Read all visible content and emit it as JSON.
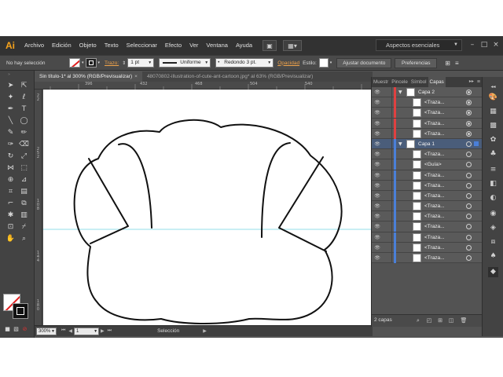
{
  "app": {
    "logo": "Ai"
  },
  "menubar": {
    "items": [
      "Archivo",
      "Edición",
      "Objeto",
      "Texto",
      "Seleccionar",
      "Efecto",
      "Ver",
      "Ventana",
      "Ayuda"
    ],
    "workspace": "Aspectos esenciales",
    "window_controls": {
      "minimize": "–",
      "maximize": "□",
      "close": "×"
    }
  },
  "controlbar": {
    "selection_status": "No hay selección",
    "stroke_label": "Trazo:",
    "stroke_weight": "1 pt",
    "stroke_profile": "Uniforme",
    "brush": "Redondo 3 pt.",
    "opacity_label": "Opacidad",
    "style_label": "Estilo:",
    "doc_setup_button": "Ajustar documento",
    "preferences_button": "Preferencias"
  },
  "tabs": [
    {
      "label": "Sin título-1* al 300% (RGB/Previsualizar)",
      "active": true
    },
    {
      "label": "48070802-illustration-of-cute-ant-cartoon.jpg* al 63% (RGB/Previsualizar)",
      "active": false
    }
  ],
  "ruler": {
    "top_labels": [
      "396",
      "432",
      "468",
      "504",
      "540"
    ],
    "left_labels": [
      "2\n2",
      "2\n5\n2",
      "1\n0\n8",
      "1\n4\n4",
      "1\n8\n0"
    ]
  },
  "statusbar": {
    "zoom": "300%",
    "artboard": "1",
    "tool_name": "Selección"
  },
  "layers_panel": {
    "tabs": [
      "Muestr",
      "Pincele",
      "Símbol",
      "Capas"
    ],
    "active_tab": "Capas",
    "layers": [
      {
        "name": "Capa 2",
        "level": 0,
        "expanded": true,
        "color": "#e04040",
        "target": "filled"
      },
      {
        "name": "<Traza...",
        "level": 1,
        "color": "#e04040",
        "target": "filled"
      },
      {
        "name": "<Traza...",
        "level": 1,
        "color": "#e04040",
        "target": "filled"
      },
      {
        "name": "<Traza...",
        "level": 1,
        "color": "#e04040",
        "target": "filled"
      },
      {
        "name": "<Traza...",
        "level": 1,
        "color": "#e04040",
        "target": "filled"
      },
      {
        "name": "Capa 1",
        "level": 0,
        "expanded": true,
        "color": "#4a7fd8",
        "target": "open",
        "selected": true
      },
      {
        "name": "<Traza...",
        "level": 1,
        "color": "#4a7fd8",
        "target": "open"
      },
      {
        "name": "<Guía>",
        "level": 1,
        "color": "#4a7fd8",
        "target": "open"
      },
      {
        "name": "<Traza...",
        "level": 1,
        "color": "#4a7fd8",
        "target": "open"
      },
      {
        "name": "<Traza...",
        "level": 1,
        "color": "#4a7fd8",
        "target": "open"
      },
      {
        "name": "<Traza...",
        "level": 1,
        "color": "#4a7fd8",
        "target": "open"
      },
      {
        "name": "<Traza...",
        "level": 1,
        "color": "#4a7fd8",
        "target": "open"
      },
      {
        "name": "<Traza...",
        "level": 1,
        "color": "#4a7fd8",
        "target": "open"
      },
      {
        "name": "<Traza...",
        "level": 1,
        "color": "#4a7fd8",
        "target": "open"
      },
      {
        "name": "<Traza...",
        "level": 1,
        "color": "#4a7fd8",
        "target": "open"
      },
      {
        "name": "<Traza...",
        "level": 1,
        "color": "#4a7fd8",
        "target": "open"
      },
      {
        "name": "<Traza...",
        "level": 1,
        "color": "#4a7fd8",
        "target": "open"
      }
    ],
    "count_label": "2 capas"
  },
  "colors": {
    "accent_orange": "#f7a31c",
    "layer2_red": "#e04040",
    "layer1_blue": "#4a7fd8",
    "guide": "#6fd3e0"
  }
}
